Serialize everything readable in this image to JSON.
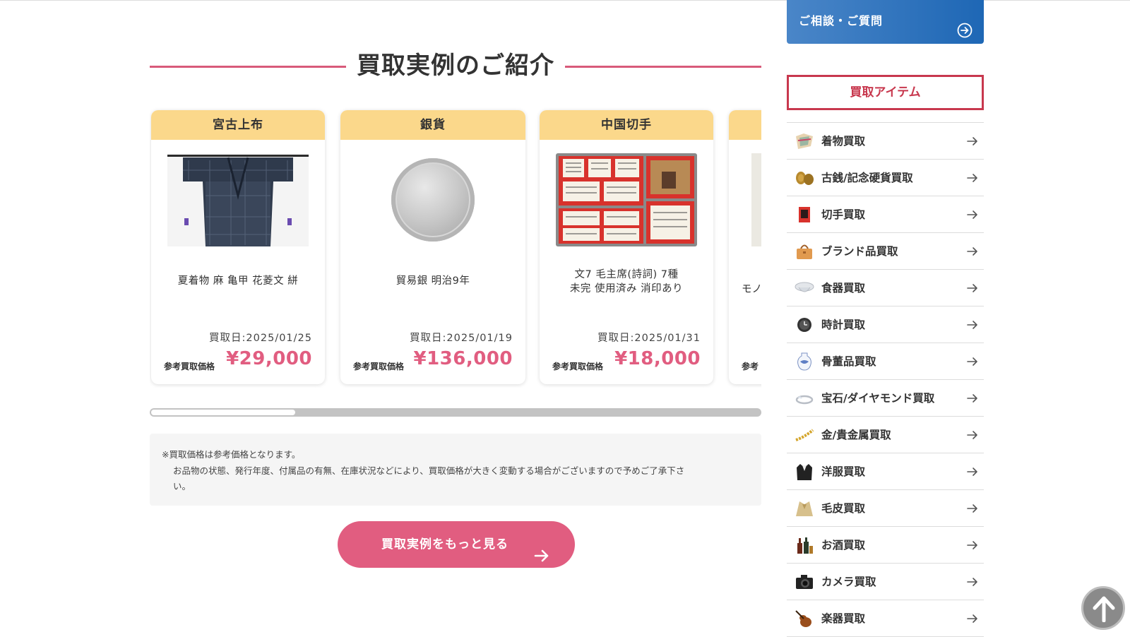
{
  "section": {
    "title": "買取実例のご紹介"
  },
  "cards": [
    {
      "category": "宮古上布",
      "name_line1": "夏着物 麻 亀甲 花菱文 絣",
      "name_line2": "",
      "date": "買取日:2025/01/25",
      "price_label": "参考買取価格",
      "price": "¥29,000",
      "image": "kimono-photo"
    },
    {
      "category": "銀貨",
      "name_line1": "貿易銀 明治9年",
      "name_line2": "",
      "date": "買取日:2025/01/19",
      "price_label": "参考買取価格",
      "price": "¥136,000",
      "image": "silver-coin-photo"
    },
    {
      "category": "中国切手",
      "name_line1": "文7 毛主席(詩詞) 7種",
      "name_line2": "未完 使用済み 消印あり",
      "date": "買取日:2025/01/31",
      "price_label": "参考買取価格",
      "price": "¥18,000",
      "image": "chinese-stamps-photo"
    },
    {
      "category": "",
      "name_line1": "モノ",
      "name_line2": "",
      "date": "",
      "price_label": "参考",
      "price": ""
    }
  ],
  "carousel": {
    "scroll_position": 0.25
  },
  "note": {
    "line1": "※買取価格は参考価格となります。",
    "line2": "お品物の状態、発行年度、付属品の有無、在庫状況などにより、買取価格が大きく変動する場合がございますので予めご了承下さ",
    "line3": "い。"
  },
  "more_button": {
    "label": "買取実例をもっと見る"
  },
  "sidebar": {
    "consult_label": "ご相談・ご質問",
    "items_heading": "買取アイテム",
    "items": [
      {
        "label": "着物買取",
        "icon": "kimono-icon"
      },
      {
        "label": "古銭/記念硬貨買取",
        "icon": "coin-icon"
      },
      {
        "label": "切手買取",
        "icon": "stamp-icon"
      },
      {
        "label": "ブランド品買取",
        "icon": "handbag-icon"
      },
      {
        "label": "食器買取",
        "icon": "tableware-icon"
      },
      {
        "label": "時計買取",
        "icon": "watch-icon"
      },
      {
        "label": "骨董品買取",
        "icon": "antique-vase-icon"
      },
      {
        "label": "宝石/ダイヤモンド買取",
        "icon": "ring-icon"
      },
      {
        "label": "金/貴金属買取",
        "icon": "gold-chain-icon"
      },
      {
        "label": "洋服買取",
        "icon": "jacket-icon"
      },
      {
        "label": "毛皮買取",
        "icon": "fur-icon"
      },
      {
        "label": "お酒買取",
        "icon": "liquor-icon"
      },
      {
        "label": "カメラ買取",
        "icon": "camera-icon"
      },
      {
        "label": "楽器買取",
        "icon": "violin-icon"
      }
    ]
  },
  "colors": {
    "accent_pink": "#e15d80",
    "card_header": "#fbd88b",
    "consult_blue": "#1e67b5",
    "heading_red": "#c8384e"
  }
}
